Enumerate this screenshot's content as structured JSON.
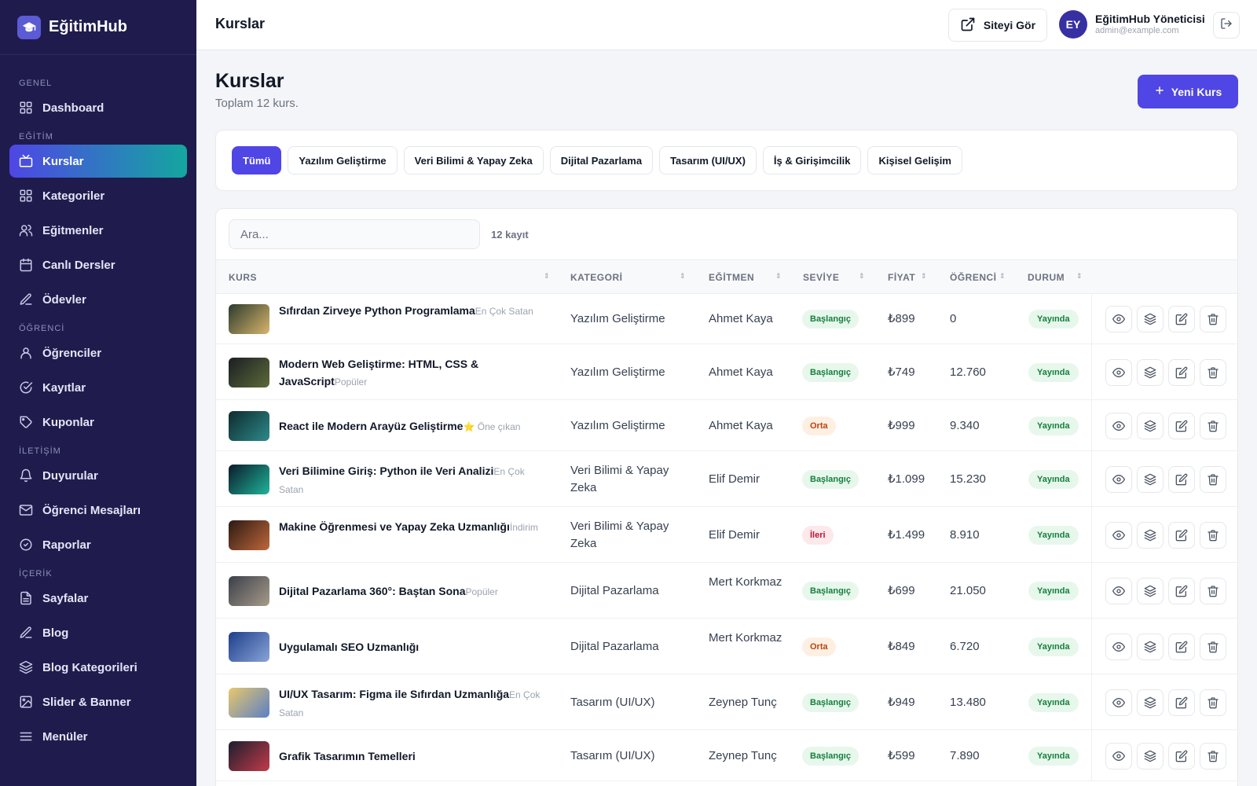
{
  "brand": {
    "name": "EğitimHub"
  },
  "sidebar": {
    "groups": [
      {
        "title": "GENEL",
        "items": [
          {
            "label": "Dashboard",
            "icon": "grid-icon"
          }
        ]
      },
      {
        "title": "EĞİTİM",
        "items": [
          {
            "label": "Kurslar",
            "icon": "tv-icon",
            "active": true
          },
          {
            "label": "Kategoriler",
            "icon": "grid-icon"
          },
          {
            "label": "Eğitmenler",
            "icon": "users-icon"
          },
          {
            "label": "Canlı Dersler",
            "icon": "calendar-icon"
          },
          {
            "label": "Ödevler",
            "icon": "edit-icon"
          }
        ]
      },
      {
        "title": "ÖĞRENCİ",
        "items": [
          {
            "label": "Öğrenciler",
            "icon": "user-icon"
          },
          {
            "label": "Kayıtlar",
            "icon": "check-circle-icon"
          },
          {
            "label": "Kuponlar",
            "icon": "tag-icon"
          }
        ]
      },
      {
        "title": "İLETİŞİM",
        "items": [
          {
            "label": "Duyurular",
            "icon": "bell-icon"
          },
          {
            "label": "Öğrenci Mesajları",
            "icon": "mail-icon"
          },
          {
            "label": "Raporlar",
            "icon": "clock-icon"
          }
        ]
      },
      {
        "title": "İÇERİK",
        "items": [
          {
            "label": "Sayfalar",
            "icon": "file-icon"
          },
          {
            "label": "Blog",
            "icon": "edit-icon"
          },
          {
            "label": "Blog Kategorileri",
            "icon": "layers-icon"
          },
          {
            "label": "Slider & Banner",
            "icon": "image-icon"
          },
          {
            "label": "Menüler",
            "icon": "menu-icon"
          }
        ]
      }
    ]
  },
  "topbar": {
    "title": "Kurslar",
    "site_button": "Siteyi Gör",
    "user": {
      "initials": "EY",
      "name": "EğitimHub Yöneticisi",
      "email": "admin@example.com"
    }
  },
  "page": {
    "title": "Kurslar",
    "subtitle": "Toplam 12 kurs.",
    "new_button": "Yeni Kurs"
  },
  "filters": [
    "Tümü",
    "Yazılım Geliştirme",
    "Veri Bilimi & Yapay Zeka",
    "Dijital Pazarlama",
    "Tasarım (UI/UX)",
    "İş & Girişimcilik",
    "Kişisel Gelişim"
  ],
  "active_filter": 0,
  "table": {
    "search_placeholder": "Ara...",
    "record_count": "12 kayıt",
    "columns": [
      "KURS",
      "KATEGORİ",
      "EĞİTMEN",
      "SEVİYE",
      "FİYAT",
      "ÖĞRENCİ",
      "DURUM"
    ],
    "rows": [
      {
        "title": "Sıfırdan Zirveye Python Programlama",
        "tag": "En Çok Satan",
        "category": "Yazılım Geliştirme",
        "instructor": "Ahmet Kaya",
        "level": "Başlangıç",
        "level_key": "baslangic",
        "price": "₺899",
        "students": "0",
        "status": "Yayında",
        "thumb": [
          "#2b3b2e",
          "#d9b56b"
        ]
      },
      {
        "title": "Modern Web Geliştirme: HTML, CSS & JavaScript",
        "tag": "Popüler",
        "category": "Yazılım Geliştirme",
        "instructor": "Ahmet Kaya",
        "level": "Başlangıç",
        "level_key": "baslangic",
        "price": "₺749",
        "students": "12.760",
        "status": "Yayında",
        "thumb": [
          "#1b1d24",
          "#5b6b3a"
        ]
      },
      {
        "title": "React ile Modern Arayüz Geliştirme",
        "tag": "⭐ Öne çıkan",
        "category": "Yazılım Geliştirme",
        "instructor": "Ahmet Kaya",
        "level": "Orta",
        "level_key": "orta",
        "price": "₺999",
        "students": "9.340",
        "status": "Yayında",
        "thumb": [
          "#0f2a2e",
          "#2d8a8a"
        ]
      },
      {
        "title": "Veri Bilimine Giriş: Python ile Veri Analizi",
        "tag": "En Çok Satan",
        "category": "Veri Bilimi & Yapay Zeka",
        "instructor": "Elif Demir",
        "level": "Başlangıç",
        "level_key": "baslangic",
        "price": "₺1.099",
        "students": "15.230",
        "status": "Yayında",
        "thumb": [
          "#0b1a2a",
          "#1fb59a"
        ]
      },
      {
        "title": "Makine Öğrenmesi ve Yapay Zeka Uzmanlığı",
        "tag": "İndirim",
        "category": "Veri Bilimi & Yapay Zeka",
        "instructor": "Elif Demir",
        "level": "İleri",
        "level_key": "ileri",
        "price": "₺1.499",
        "students": "8.910",
        "status": "Yayında",
        "thumb": [
          "#2a1a14",
          "#c0673a"
        ]
      },
      {
        "title": "Dijital Pazarlama 360°: Baştan Sona",
        "tag": "Popüler",
        "category": "Dijital Pazarlama",
        "instructor": "Mert Korkmaz",
        "level": "Başlangıç",
        "level_key": "baslangic",
        "price": "₺699",
        "students": "21.050",
        "status": "Yayında",
        "thumb": [
          "#3a3f4a",
          "#a89b8a"
        ]
      },
      {
        "title": "Uygulamalı SEO Uzmanlığı",
        "tag": "",
        "category": "Dijital Pazarlama",
        "instructor": "Mert Korkmaz",
        "level": "Orta",
        "level_key": "orta",
        "price": "₺849",
        "students": "6.720",
        "status": "Yayında",
        "thumb": [
          "#1d3f8a",
          "#8aa4d8"
        ]
      },
      {
        "title": "UI/UX Tasarım: Figma ile Sıfırdan Uzmanlığa",
        "tag": "En Çok Satan",
        "category": "Tasarım (UI/UX)",
        "instructor": "Zeynep Tunç",
        "level": "Başlangıç",
        "level_key": "baslangic",
        "price": "₺949",
        "students": "13.480",
        "status": "Yayında",
        "thumb": [
          "#e8c86a",
          "#5a7fc8"
        ]
      },
      {
        "title": "Grafik Tasarımın Temelleri",
        "tag": "",
        "category": "Tasarım (UI/UX)",
        "instructor": "Zeynep Tunç",
        "level": "Başlangıç",
        "level_key": "baslangic",
        "price": "₺599",
        "students": "7.890",
        "status": "Yayında",
        "thumb": [
          "#1a1f2e",
          "#c43a4a"
        ]
      }
    ]
  },
  "colors": {
    "accent": "#4f46e5",
    "sidebar_bg": "#1f1c4d",
    "active_gradient_end": "#14a6a0",
    "success": "#15803d"
  }
}
